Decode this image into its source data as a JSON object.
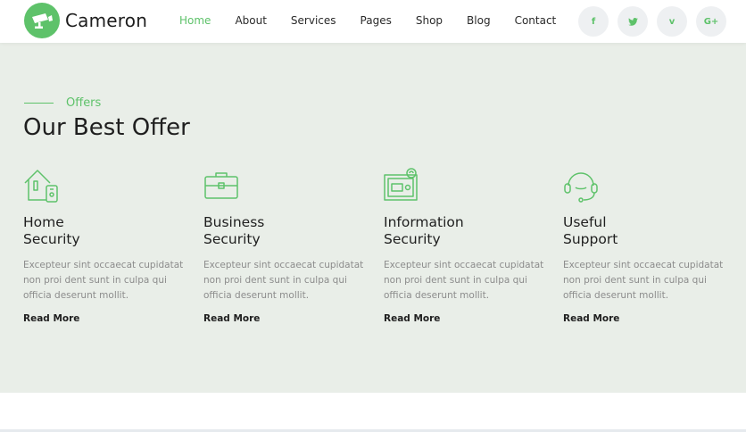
{
  "brand": {
    "name": "Cameron",
    "accent": "#5ec26a",
    "logo_icon": "cctv-camera-icon"
  },
  "nav": [
    {
      "label": "Home",
      "active": true
    },
    {
      "label": "About"
    },
    {
      "label": "Services"
    },
    {
      "label": "Pages"
    },
    {
      "label": "Shop"
    },
    {
      "label": "Blog"
    },
    {
      "label": "Contact"
    }
  ],
  "social": [
    {
      "icon": "facebook-icon",
      "glyph": "f"
    },
    {
      "icon": "twitter-icon",
      "glyph": "🐦"
    },
    {
      "icon": "vimeo-icon",
      "glyph": "v"
    },
    {
      "icon": "google-plus-icon",
      "glyph": "G+"
    }
  ],
  "offers": {
    "eyebrow": "Offers",
    "title": "Our Best Offer",
    "cards": [
      {
        "icon": "smart-home-icon",
        "title_line1": "Home",
        "title_line2": "Security",
        "description": "Excepteur sint occaecat cupidatat non proi dent sunt in culpa qui officia deserunt mollit.",
        "link": "Read More"
      },
      {
        "icon": "briefcase-icon",
        "title_line1": "Business",
        "title_line2": "Security",
        "description": "Excepteur sint occaecat cupidatat non proi dent sunt in culpa qui officia deserunt mollit.",
        "link": "Read More"
      },
      {
        "icon": "safe-icon",
        "title_line1": "Information",
        "title_line2": "Security",
        "description": "Excepteur sint occaecat cupidatat non proi dent sunt in culpa qui officia deserunt mollit.",
        "link": "Read More"
      },
      {
        "icon": "headset-icon",
        "title_line1": "Useful",
        "title_line2": "Support",
        "description": "Excepteur sint occaecat cupidatat non proi dent sunt in culpa qui officia deserunt mollit.",
        "link": "Read More"
      }
    ]
  }
}
